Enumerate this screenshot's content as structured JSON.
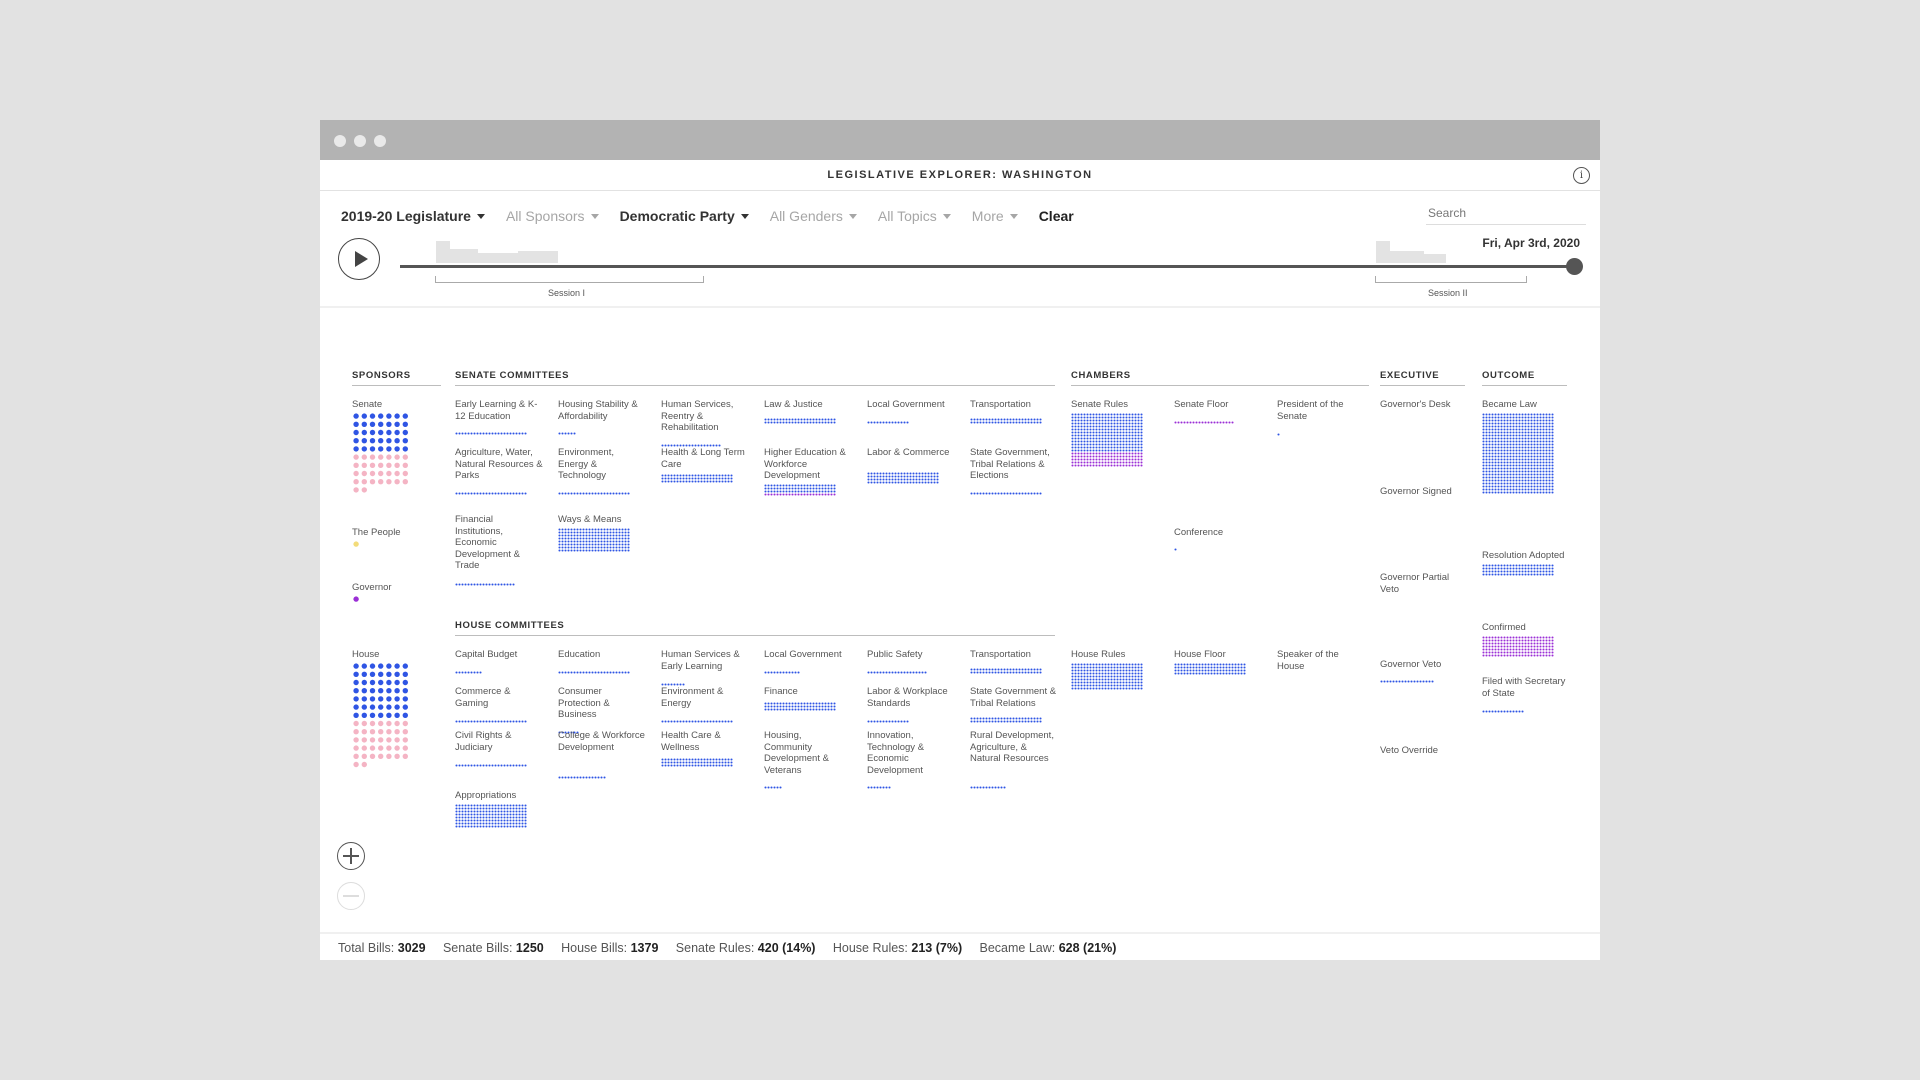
{
  "app_title": "LEGISLATIVE EXPLORER: WASHINGTON",
  "filters": [
    {
      "label": "2019-20 Legislature",
      "active": true
    },
    {
      "label": "All Sponsors",
      "active": false
    },
    {
      "label": "Democratic Party",
      "active": true
    },
    {
      "label": "All Genders",
      "active": false
    },
    {
      "label": "All Topics",
      "active": false
    },
    {
      "label": "More",
      "active": false
    }
  ],
  "clear_label": "Clear",
  "search": {
    "placeholder": "Search",
    "value": ""
  },
  "timeline": {
    "current_date": "Fri, Apr 3rd, 2020",
    "session1": "Session I",
    "session2": "Session II",
    "progress": 1.0
  },
  "colors": {
    "blue": "#2f55e4",
    "pink": "#f4b4c4",
    "purple": "#9b2fd6",
    "yellow": "#f3dc7a"
  },
  "sections": {
    "sponsors": "SPONSORS",
    "senate_committees": "SENATE COMMITTEES",
    "house_committees": "HOUSE COMMITTEES",
    "chambers": "CHAMBERS",
    "executive": "EXECUTIVE",
    "outcome": "OUTCOME"
  },
  "sponsors": {
    "senate": "Senate",
    "people": "The People",
    "governor": "Governor",
    "house": "House"
  },
  "senate_committees": [
    "Early Learning & K-12 Education",
    "Housing Stability & Affordability",
    "Human Services, Reentry & Rehabilitation",
    "Law & Justice",
    "Local Government",
    "Transportation",
    "Agriculture, Water, Natural Resources & Parks",
    "Environment, Energy & Technology",
    "Health & Long Term Care",
    "Higher Education & Workforce Development",
    "Labor & Commerce",
    "State Government, Tribal Relations & Elections",
    "Financial Institutions, Economic Development & Trade",
    "Ways & Means"
  ],
  "house_committees": [
    "Capital Budget",
    "Education",
    "Human Services & Early Learning",
    "Local Government",
    "Public Safety",
    "Transportation",
    "Commerce & Gaming",
    "Consumer Protection & Business",
    "Environment & Energy",
    "Finance",
    "Labor & Workplace Standards",
    "State Government & Tribal Relations",
    "Civil Rights & Judiciary",
    "College & Workforce Development",
    "Health Care & Wellness",
    "Housing, Community Development & Veterans",
    "Innovation, Technology & Economic Development",
    "Rural Development, Agriculture, & Natural Resources",
    "Appropriations"
  ],
  "chambers": {
    "senate_rules": "Senate Rules",
    "senate_floor": "Senate Floor",
    "president_senate": "President of the Senate",
    "conference": "Conference",
    "house_rules": "House Rules",
    "house_floor": "House Floor",
    "speaker_house": "Speaker of the House"
  },
  "executive": {
    "desk": "Governor's Desk",
    "signed": "Governor Signed",
    "partial_veto": "Governor Partial Veto",
    "veto": "Governor Veto",
    "override": "Veto Override"
  },
  "outcome": {
    "became_law": "Became Law",
    "resolution": "Resolution Adopted",
    "confirmed": "Confirmed",
    "filed": "Filed with Secretary of State"
  },
  "stats": [
    {
      "label": "Total Bills:",
      "value": "3029"
    },
    {
      "label": "Senate Bills:",
      "value": "1250"
    },
    {
      "label": "House Bills:",
      "value": "1379"
    },
    {
      "label": "Senate Rules:",
      "value": "420 (14%)"
    },
    {
      "label": "House Rules:",
      "value": "213 (7%)"
    },
    {
      "label": "Became Law:",
      "value": "628 (21%)"
    }
  ]
}
